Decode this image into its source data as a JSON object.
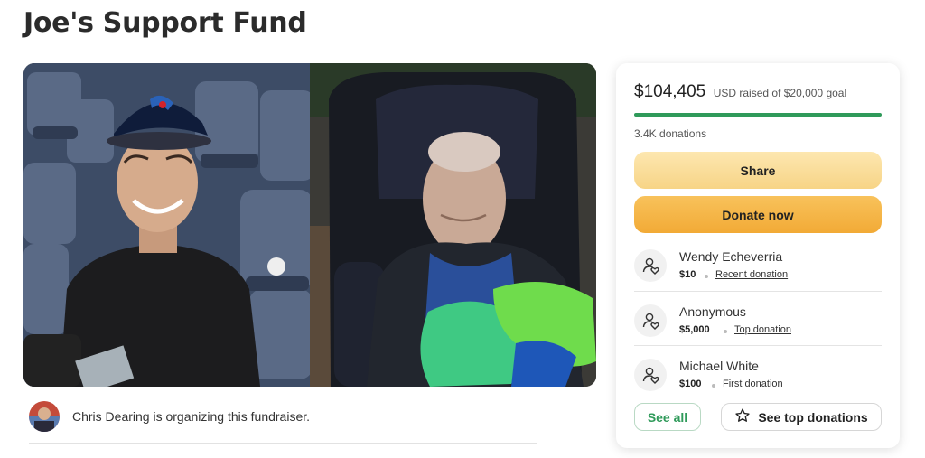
{
  "page": {
    "title": "Joe's Support Fund"
  },
  "organizer": {
    "text": "Chris Dearing is organizing this fundraiser."
  },
  "progress": {
    "amount": "$104,405",
    "meta": "USD raised of $20,000 goal",
    "fraction": 1.0,
    "donations": "3.4K donations"
  },
  "buttons": {
    "share": "Share",
    "donate": "Donate now",
    "see_all": "See all",
    "see_top": "See top donations"
  },
  "donors": [
    {
      "name": "Wendy Echeverria",
      "amount": "$10",
      "tag": "Recent donation"
    },
    {
      "name": "Anonymous",
      "amount": "$5,000",
      "tag": "Top donation"
    },
    {
      "name": "Michael White",
      "amount": "$100",
      "tag": "First donation"
    }
  ],
  "icons": {
    "donor": "donor-heart-icon",
    "star": "star-icon"
  },
  "colors": {
    "progress": "#2f9a5a",
    "share_bg": "#f7d486",
    "donate_bg": "#f2aa36",
    "see_all_text": "#2f9a5a"
  }
}
